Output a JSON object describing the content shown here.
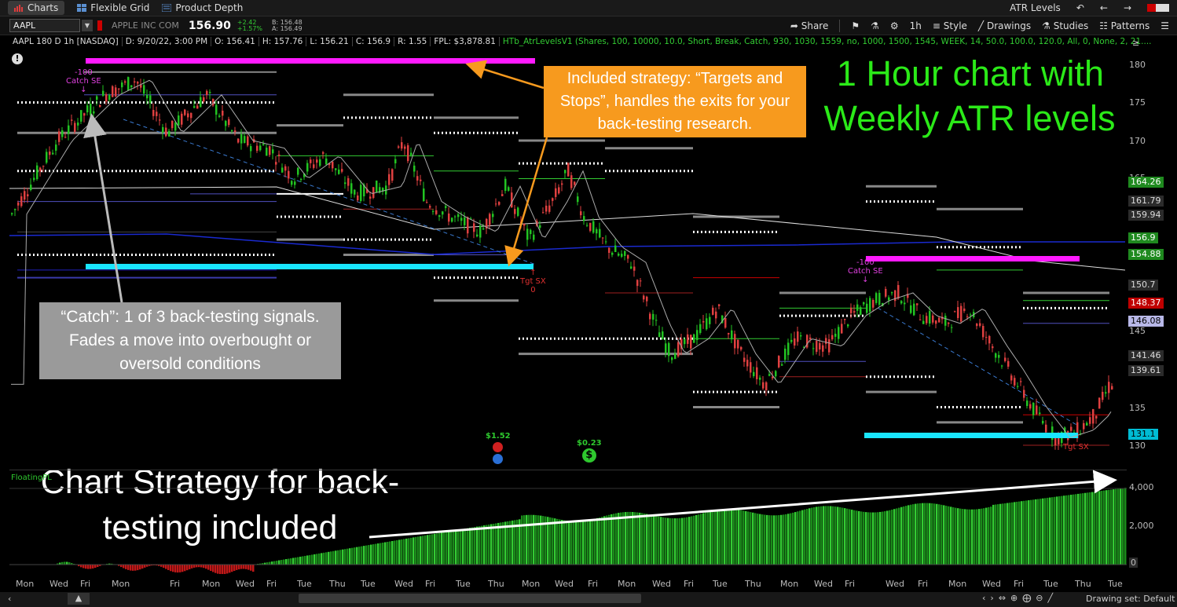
{
  "tabs": {
    "charts": "Charts",
    "flexible_grid": "Flexible Grid",
    "product_depth": "Product Depth"
  },
  "topbar_right": {
    "title": "ATR Levels"
  },
  "symbol_bar": {
    "symbol": "AAPL",
    "company": "APPLE INC COM",
    "last": "156.90",
    "change": "+2.42",
    "change_pct": "+1.57%",
    "bid": "B: 156.48",
    "ask": "A: 156.49"
  },
  "toolbar": {
    "share": "Share",
    "timeframe": "1h",
    "style": "Style",
    "drawings": "Drawings",
    "studies": "Studies",
    "patterns": "Patterns"
  },
  "study_line": {
    "symbol_desc": "AAPL 180 D 1h [NASDAQ]",
    "date": "D: 9/20/22, 3:00 PM",
    "open": "O: 156.41",
    "high": "H: 157.76",
    "low": "L: 156.21",
    "close": "C: 156.9",
    "range": "R: 1.55",
    "fpl": "FPL: $3,878.81",
    "strategy": "HTb_AtrLevelsV1 (Shares, 100, 10000, 10.0, Short, Break, Catch, 930, 1030, 1559, no, 1000, 1500, 1545, WEEK, 14, 50.0, 100.0, 120.0, All, 0, None, 2, 21...."
  },
  "price_axis": {
    "ticks": [
      "180",
      "175",
      "170",
      "165",
      "145",
      "135",
      "130"
    ],
    "badges": [
      {
        "text": "164.26",
        "bg": "#1f8a1f",
        "fg": "#fff"
      },
      {
        "text": "161.79",
        "bg": "#2b2b2b",
        "fg": "#ddd"
      },
      {
        "text": "159.94",
        "bg": "#2b2b2b",
        "fg": "#ddd"
      },
      {
        "text": "156.9",
        "bg": "#1f8a1f",
        "fg": "#fff"
      },
      {
        "text": "154.88",
        "bg": "#1f8a1f",
        "fg": "#fff"
      },
      {
        "text": "150.7",
        "bg": "#2b2b2b",
        "fg": "#ddd"
      },
      {
        "text": "148.37",
        "bg": "#c00000",
        "fg": "#fff"
      },
      {
        "text": "146.08",
        "bg": "#b8b8e8",
        "fg": "#000"
      },
      {
        "text": "141.46",
        "bg": "#2b2b2b",
        "fg": "#ddd"
      },
      {
        "text": "139.61",
        "bg": "#2b2b2b",
        "fg": "#ddd"
      },
      {
        "text": "131.1",
        "bg": "#00bcd4",
        "fg": "#000"
      }
    ]
  },
  "volume_axis": {
    "ticks": [
      "4,000",
      "2,000",
      "0"
    ]
  },
  "annotations": {
    "included_strategy": "Included strategy: “Targets and Stops”, handles the exits for your back-testing research.",
    "title_line1": "1 Hour chart with",
    "title_line2": "Weekly ATR levels",
    "catch_note": "“Catch”: 1 of 3 back-testing signals. Fades a move into overbought or oversold conditions",
    "strategy_line1": "Chart Strategy for back-",
    "strategy_line2": "testing included"
  },
  "signals": {
    "catch_se_1_qty": "-100",
    "catch_se_1": "Catch SE",
    "catch_se_2_qty": "-100",
    "catch_se_2": "Catch SE",
    "tgt_sx_1": "Tgt SX",
    "tgt_sx_1_qty": "0",
    "tgt_sx_2": "Tgt SX",
    "div_1": "$1.52",
    "div_2": "$0.23"
  },
  "subpanel": {
    "label": "FloatingPL"
  },
  "date_axis": [
    "Mon",
    "Wed",
    "Fri",
    "Mon",
    "Fri",
    "Mon",
    "Wed",
    "Fri",
    "Tue",
    "Thu",
    "Tue",
    "Wed",
    "Fri",
    "Tue",
    "Thu",
    "Mon",
    "Wed",
    "Fri",
    "Mon",
    "Wed",
    "Fri",
    "Tue",
    "Thu",
    "Mon",
    "Wed",
    "Fri",
    "Wed",
    "Fri",
    "Mon",
    "Wed",
    "Fri",
    "Tue",
    "Thu",
    "Tue"
  ],
  "bottom_bar": {
    "drawing_set": "Drawing set: Default"
  }
}
